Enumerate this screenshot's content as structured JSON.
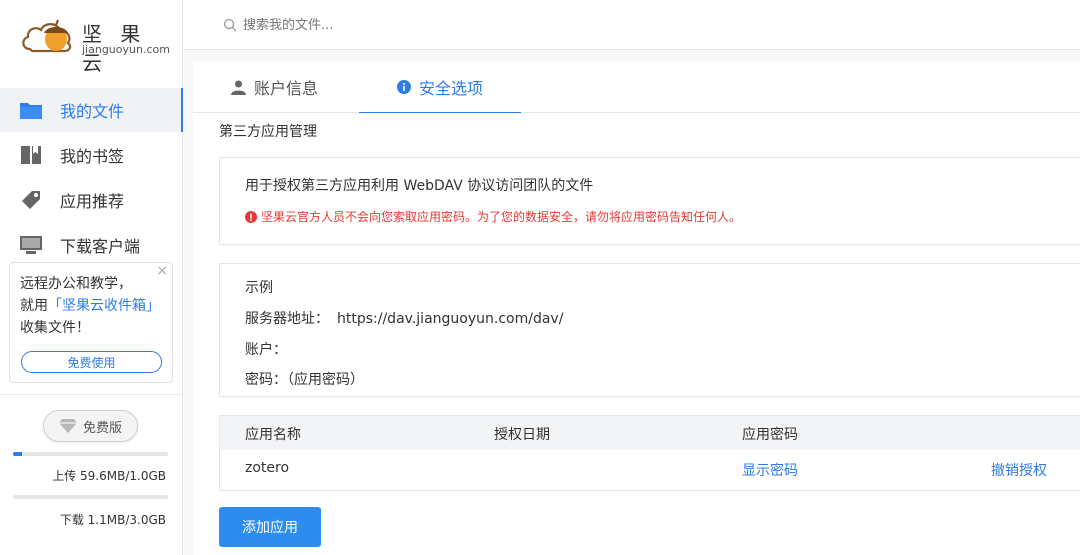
{
  "brand": {
    "name_cn": "坚 果 云",
    "domain": "jianguoyun.com",
    "logo_icon": "acorn-cloud-logo"
  },
  "sidebar": {
    "items": [
      {
        "label": "我的文件",
        "icon": "folder-icon",
        "active": true
      },
      {
        "label": "我的书签",
        "icon": "bookmark-icon",
        "active": false
      },
      {
        "label": "应用推荐",
        "icon": "tag-icon",
        "active": false
      },
      {
        "label": "下载客户端",
        "icon": "monitor-icon",
        "active": false
      }
    ],
    "promo": {
      "line1": "远程办公和教学，",
      "line2_prefix": "就用",
      "line2_highlight": "「坚果云收件箱」",
      "line3": "收集文件！",
      "button": "免费使用",
      "close": "×"
    },
    "plan": "免费版",
    "upload": {
      "label": "上传 59.6MB/1.0GB",
      "fraction": 0.058
    },
    "download": {
      "label": "下载 1.1MB/3.0GB",
      "fraction": 0.0004
    }
  },
  "search": {
    "placeholder": "搜索我的文件..."
  },
  "tabs": [
    {
      "label": "账户信息",
      "icon": "user-icon",
      "active": false
    },
    {
      "label": "安全选项",
      "icon": "info-icon",
      "active": true
    }
  ],
  "section": {
    "title": "第三方应用管理",
    "description": "用于授权第三方应用利用 WebDAV 协议访问团队的文件",
    "warning": "坚果云官方人员不会向您索取应用密码。为了您的数据安全，请勿将应用密码告知任何人。"
  },
  "example": {
    "title": "示例",
    "server_label": "服务器地址：",
    "server_value": "https://dav.jianguoyun.com/dav/",
    "account_label": "账户：",
    "password_label": "密码：",
    "password_value": "（应用密码）"
  },
  "table": {
    "headers": [
      "应用名称",
      "授权日期",
      "应用密码"
    ],
    "rows": [
      {
        "name": "zotero",
        "date": "",
        "show_password": "显示密码",
        "revoke": "撤销授权"
      }
    ]
  },
  "add_button": "添加应用",
  "colors": {
    "accent": "#2d7ce8",
    "warning": "#e53935",
    "button": "#2d8cf0"
  }
}
